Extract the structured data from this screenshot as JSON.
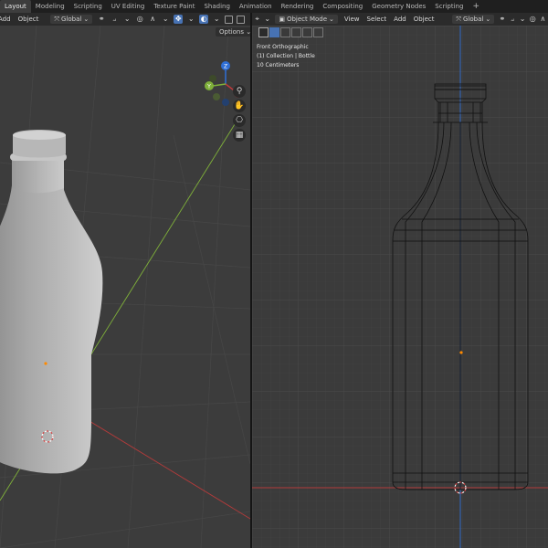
{
  "workspace_tabs": [
    "Layout",
    "Modeling",
    "Scripting",
    "UV Editing",
    "Texture Paint",
    "Shading",
    "Animation",
    "Rendering",
    "Compositing",
    "Geometry Nodes",
    "Scripting",
    "+"
  ],
  "left_header": {
    "add_label": "Add",
    "object_label": "Object",
    "orientation_label": "Global"
  },
  "right_header": {
    "mode_label": "Object Mode",
    "view_label": "View",
    "select_label": "Select",
    "add_label": "Add",
    "object_label": "Object",
    "orientation_label": "Global"
  },
  "options_label": "Options",
  "gizmo": {
    "y": "Y",
    "z": "Z",
    "x": "X"
  },
  "viewport_right": {
    "view_name": "Front Orthographic",
    "collection": "(1) Collection | Bottle",
    "scale": "10 Centimeters"
  },
  "colors": {
    "active_tab": "#3d3d3d",
    "accent_blue": "#4772b3",
    "x_axis": "#c0393b",
    "y_axis": "#7fb03a",
    "z_axis": "#2f6fd6"
  }
}
